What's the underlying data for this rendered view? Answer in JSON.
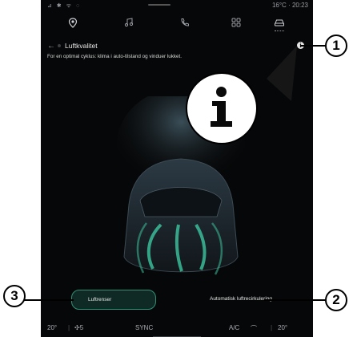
{
  "status_bar": {
    "signal_icons": "⊿ ✱ ᯤ ◌",
    "temperature": "16°C",
    "separator": "·",
    "time": "20:23"
  },
  "nav_tabs": [
    {
      "icon": "location-pin-icon"
    },
    {
      "icon": "music-note-icon"
    },
    {
      "icon": "phone-icon"
    },
    {
      "icon": "apps-grid-icon"
    },
    {
      "icon": "car-icon",
      "active": true
    }
  ],
  "page": {
    "back_symbol": "←",
    "title": "Luftkvalitet",
    "subtitle": "For en optimal cyklus: klima i auto-tilstand og vinduer lukket."
  },
  "buttons": {
    "purifier_label": "Luftrenser",
    "recirculation_label": "Automatisk luftrecirkulering"
  },
  "climate_bar": {
    "left_temp": "20",
    "left_temp_unit": "°",
    "fan_level": "5",
    "sync_label": "SYNC",
    "ac_label": "A/C",
    "right_temp": "20",
    "right_temp_unit": "°"
  },
  "callouts": {
    "one": "1",
    "two": "2",
    "three": "3"
  },
  "colors": {
    "accent": "#2f8f74",
    "background": "#060708",
    "airflow": "#3fd0a8"
  }
}
